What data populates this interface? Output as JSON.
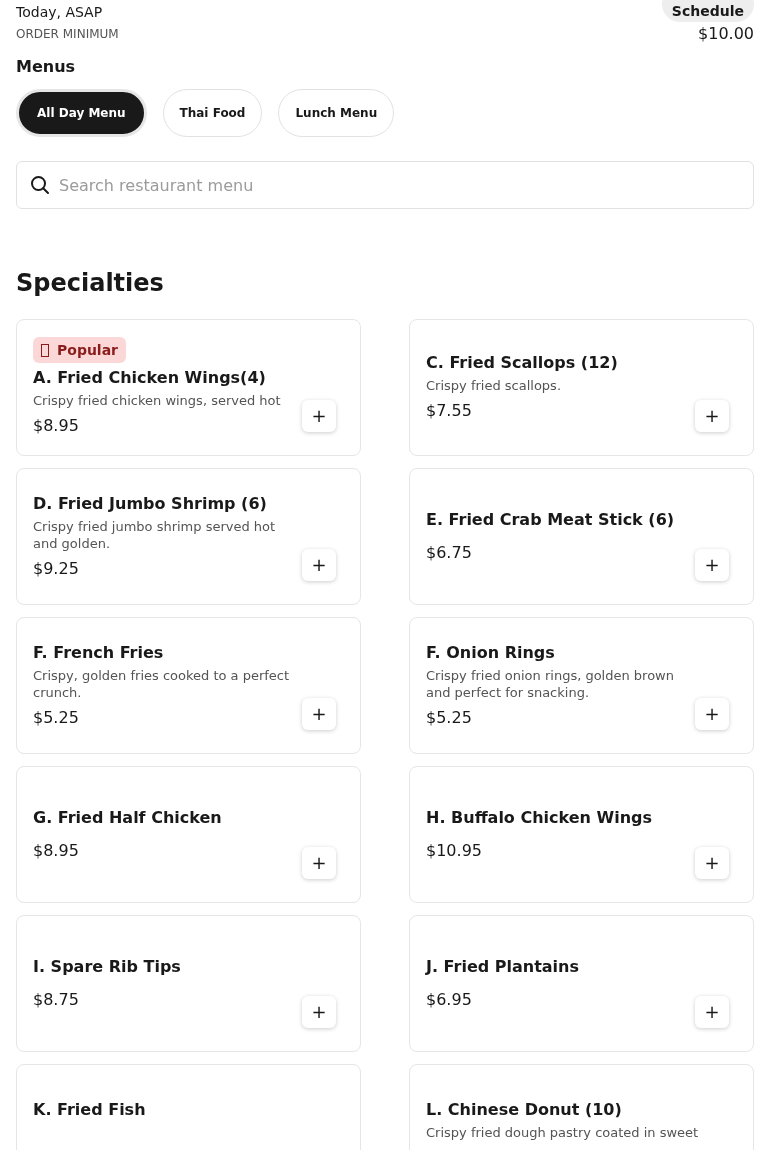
{
  "delivery": {
    "time": "Today, ASAP",
    "schedule_button": "Schedule"
  },
  "order_minimum": {
    "label": "ORDER MINIMUM",
    "value": "$10.00"
  },
  "menus": {
    "title": "Menus",
    "tabs": [
      {
        "label": "All Day Menu",
        "selected": true
      },
      {
        "label": "Thai Food",
        "selected": false
      },
      {
        "label": "Lunch Menu",
        "selected": false
      }
    ]
  },
  "search": {
    "placeholder": "Search restaurant menu"
  },
  "section": {
    "title": "Specialties",
    "items": [
      {
        "badge": "Popular",
        "name": "A. Fried Chicken Wings(4)",
        "description": "Crispy fried chicken wings, served hot",
        "price": "$8.95",
        "add": "+"
      },
      {
        "name": "C. Fried Scallops (12)",
        "description": "Crispy fried scallops.",
        "price": "$7.55",
        "add": "+"
      },
      {
        "name": "D. Fried Jumbo Shrimp (6)",
        "description": "Crispy fried jumbo shrimp served hot and golden.",
        "price": "$9.25",
        "add": "+"
      },
      {
        "name": "E. Fried Crab Meat Stick (6)",
        "price": "$6.75",
        "add": "+"
      },
      {
        "name": "F. French Fries",
        "description": "Crispy, golden fries cooked to a perfect crunch.",
        "price": "$5.25",
        "add": "+"
      },
      {
        "name": "F. Onion Rings",
        "description": "Crispy fried onion rings, golden brown and perfect for snacking.",
        "price": "$5.25",
        "add": "+"
      },
      {
        "name": "G. Fried Half Chicken",
        "price": "$8.95",
        "add": "+"
      },
      {
        "name": "H. Buffalo Chicken Wings",
        "price": "$10.95",
        "add": "+"
      },
      {
        "name": "I. Spare Rib Tips",
        "price": "$8.75",
        "add": "+"
      },
      {
        "name": "J. Fried Plantains",
        "price": "$6.95",
        "add": "+"
      },
      {
        "name": "K. Fried Fish"
      },
      {
        "name": "L. Chinese Donut (10)",
        "description": "Crispy fried dough pastry coated in sweet"
      }
    ]
  }
}
